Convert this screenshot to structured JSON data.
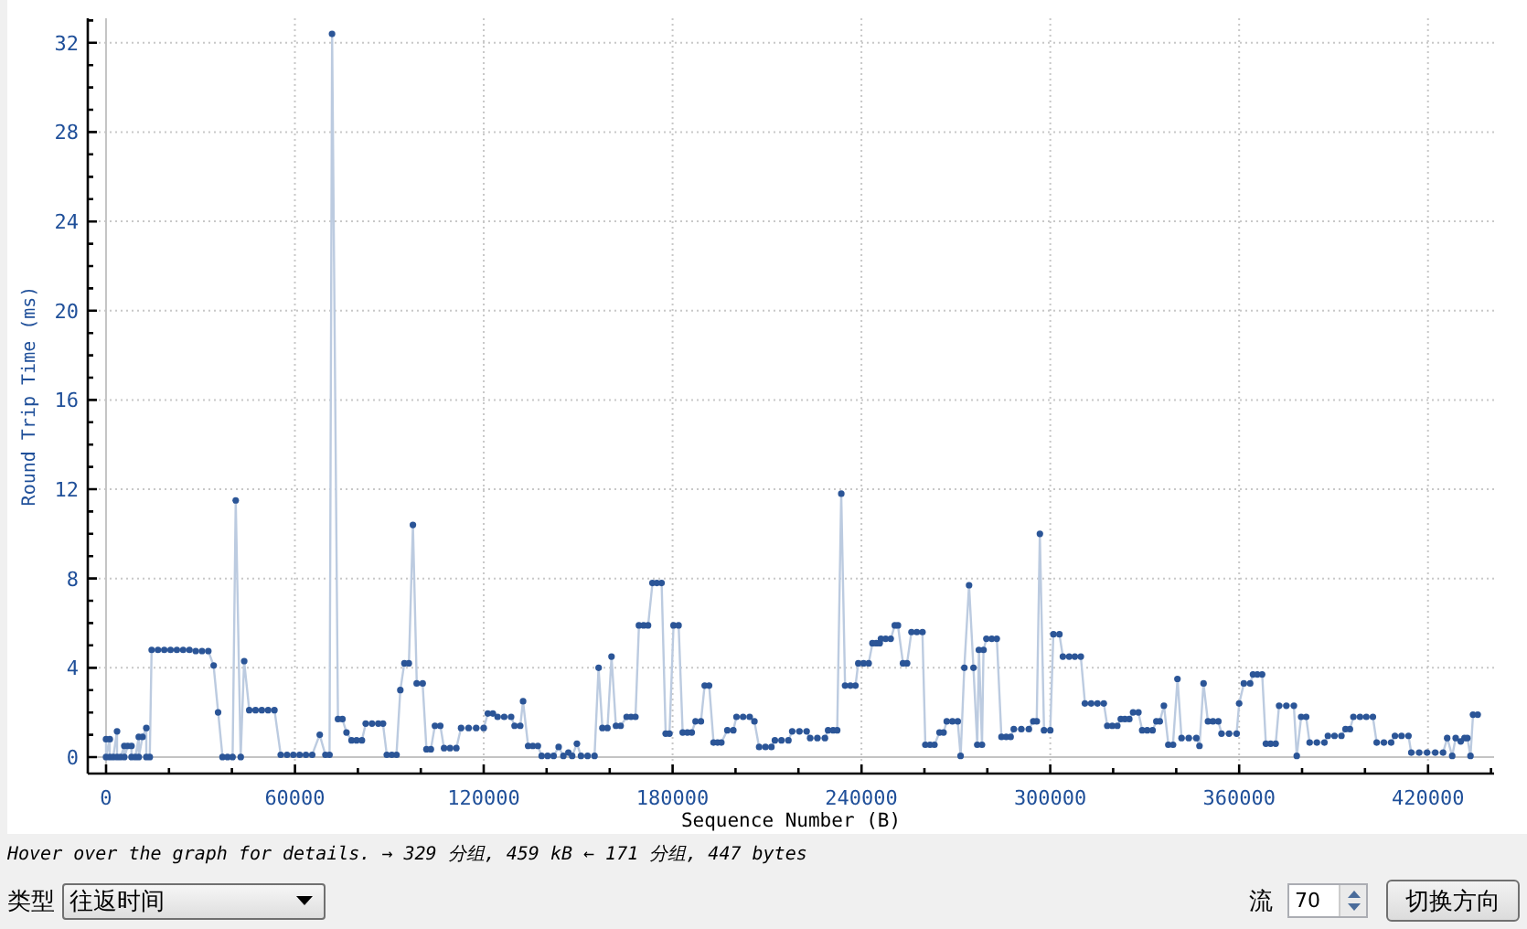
{
  "graph": {
    "chart_data": {
      "type": "line",
      "xlabel": "Sequence Number (B)",
      "ylabel": "Round Trip Time (ms)",
      "x": [
        0,
        0,
        1200,
        1200,
        2300,
        3500,
        3500,
        4600,
        5800,
        5800,
        6900,
        8100,
        8100,
        9300,
        10400,
        10400,
        11600,
        12800,
        12800,
        13900,
        14500,
        16500,
        18500,
        20500,
        22500,
        24500,
        26500,
        28500,
        30500,
        32500,
        34200,
        35600,
        37000,
        38600,
        40200,
        41200,
        42800,
        43900,
        45500,
        47500,
        49500,
        51500,
        53500,
        55500,
        57500,
        59500,
        61500,
        63500,
        65500,
        67900,
        69700,
        71000,
        71800,
        73700,
        75100,
        76400,
        78000,
        79600,
        81300,
        82500,
        84500,
        86500,
        88000,
        89200,
        90800,
        92300,
        93500,
        94800,
        96200,
        97500,
        98700,
        100600,
        101800,
        103200,
        104500,
        106200,
        107400,
        109300,
        111300,
        112800,
        115200,
        117600,
        120000,
        121300,
        122900,
        124400,
        126500,
        128700,
        129800,
        131600,
        132500,
        134100,
        135600,
        137200,
        138400,
        140300,
        142200,
        143800,
        145300,
        146900,
        148100,
        149600,
        150900,
        153000,
        155200,
        156500,
        157700,
        159300,
        160600,
        162000,
        163500,
        165400,
        166800,
        168200,
        169300,
        170800,
        172200,
        173600,
        175000,
        176500,
        177800,
        179000,
        180300,
        181900,
        183200,
        184700,
        186100,
        187300,
        189000,
        190200,
        191600,
        193000,
        194300,
        195500,
        197400,
        199300,
        200300,
        202400,
        204500,
        206000,
        207500,
        209500,
        211400,
        212500,
        214600,
        216800,
        218000,
        220300,
        222600,
        223700,
        226000,
        228400,
        229400,
        231000,
        232300,
        233600,
        234800,
        236500,
        238100,
        239000,
        240700,
        242300,
        243500,
        244700,
        245800,
        246200,
        247700,
        249300,
        250600,
        251600,
        253200,
        254500,
        255900,
        257600,
        259400,
        260300,
        261800,
        263200,
        264800,
        266100,
        267100,
        268900,
        270600,
        271500,
        272700,
        274200,
        275600,
        276800,
        277300,
        278300,
        278800,
        279700,
        281400,
        283000,
        284500,
        286000,
        287400,
        288400,
        290800,
        293200,
        294600,
        295700,
        296700,
        298000,
        300000,
        301000,
        302900,
        304000,
        306000,
        307800,
        309700,
        311000,
        313000,
        315000,
        317000,
        318100,
        319700,
        321300,
        322400,
        323700,
        325100,
        326300,
        328000,
        329200,
        330800,
        332500,
        333700,
        334800,
        336100,
        337500,
        339000,
        340400,
        341700,
        344000,
        346400,
        347400,
        348700,
        350100,
        351700,
        353400,
        354400,
        356800,
        359200,
        360000,
        361500,
        363500,
        364400,
        365800,
        367300,
        368500,
        370000,
        371600,
        372700,
        375000,
        377400,
        378300,
        379700,
        381300,
        382400,
        384700,
        387100,
        388200,
        390300,
        392500,
        393800,
        395200,
        396300,
        398400,
        400400,
        402500,
        403700,
        406000,
        408300,
        409500,
        411600,
        413800,
        414700,
        417200,
        419700,
        422300,
        424800,
        426100,
        427700,
        428800,
        430400,
        431600,
        432500,
        433500,
        434300,
        435800
      ],
      "series": [
        {
          "color": "#2b5597",
          "marker": true,
          "values": [
            0.8,
            0,
            0.8,
            0,
            0,
            1.15,
            0,
            0,
            0.5,
            0,
            0.5,
            0.5,
            0,
            0,
            0.9,
            0,
            0.9,
            1.3,
            0,
            0,
            4.8,
            4.8,
            4.8,
            4.8,
            4.8,
            4.8,
            4.8,
            4.75,
            4.75,
            4.75,
            4.1,
            2.0,
            0,
            0,
            0,
            11.5,
            0,
            4.3,
            2.1,
            2.1,
            2.1,
            2.1,
            2.1,
            0.1,
            0.1,
            0.1,
            0.1,
            0.1,
            0.1,
            1.0,
            0.1,
            0.1,
            32.4,
            1.7,
            1.7,
            1.1,
            0.75,
            0.75,
            0.75,
            1.5,
            1.5,
            1.5,
            1.5,
            0.1,
            0.1,
            0.1,
            3.0,
            4.2,
            4.2,
            10.4,
            3.3,
            3.3,
            0.35,
            0.35,
            1.4,
            1.4,
            0.4,
            0.4,
            0.4,
            1.3,
            1.3,
            1.3,
            1.3,
            1.95,
            1.95,
            1.8,
            1.8,
            1.8,
            1.4,
            1.4,
            2.5,
            0.5,
            0.5,
            0.5,
            0.05,
            0.05,
            0.05,
            0.45,
            0.05,
            0.2,
            0.05,
            0.6,
            0.05,
            0.05,
            0.05,
            4.0,
            1.3,
            1.3,
            4.5,
            1.4,
            1.4,
            1.8,
            1.8,
            1.8,
            5.9,
            5.9,
            5.9,
            7.8,
            7.8,
            7.8,
            1.05,
            1.05,
            5.9,
            5.9,
            1.1,
            1.1,
            1.1,
            1.6,
            1.6,
            3.2,
            3.2,
            0.65,
            0.65,
            0.65,
            1.2,
            1.2,
            1.8,
            1.8,
            1.8,
            1.6,
            0.45,
            0.45,
            0.45,
            0.75,
            0.75,
            0.75,
            1.15,
            1.15,
            1.15,
            0.85,
            0.85,
            0.85,
            1.2,
            1.2,
            1.2,
            11.8,
            3.2,
            3.2,
            3.2,
            4.2,
            4.2,
            4.2,
            5.1,
            5.1,
            5.1,
            5.3,
            5.3,
            5.3,
            5.9,
            5.9,
            4.2,
            4.2,
            5.6,
            5.6,
            5.6,
            0.55,
            0.55,
            0.55,
            1.1,
            1.1,
            1.6,
            1.6,
            1.6,
            0.05,
            4.0,
            7.7,
            4.0,
            0.55,
            4.8,
            0.55,
            4.8,
            5.3,
            5.3,
            5.3,
            0.9,
            0.9,
            0.9,
            1.25,
            1.25,
            1.25,
            1.6,
            1.6,
            10.0,
            1.2,
            1.2,
            5.5,
            5.5,
            4.5,
            4.5,
            4.5,
            4.5,
            2.4,
            2.4,
            2.4,
            2.4,
            1.4,
            1.4,
            1.4,
            1.7,
            1.7,
            1.7,
            2.0,
            2.0,
            1.2,
            1.2,
            1.2,
            1.6,
            1.6,
            2.3,
            0.55,
            0.55,
            3.5,
            0.85,
            0.85,
            0.85,
            0.5,
            3.3,
            1.6,
            1.6,
            1.6,
            1.05,
            1.05,
            1.05,
            2.4,
            3.3,
            3.3,
            3.7,
            3.7,
            3.7,
            0.6,
            0.6,
            0.6,
            2.3,
            2.3,
            2.3,
            0.05,
            1.8,
            1.8,
            0.65,
            0.65,
            0.65,
            0.95,
            0.95,
            0.95,
            1.25,
            1.25,
            1.8,
            1.8,
            1.8,
            1.8,
            0.65,
            0.65,
            0.65,
            0.95,
            0.95,
            0.95,
            0.2,
            0.2,
            0.2,
            0.2,
            0.2,
            0.85,
            0.05,
            0.85,
            0.7,
            0.85,
            0.85,
            0.05,
            1.9,
            1.9
          ]
        }
      ],
      "grid": true,
      "xlim": [
        -5800,
        441000
      ],
      "ylim": [
        -0.74,
        33.1
      ],
      "xticks": [
        0,
        60000,
        120000,
        180000,
        240000,
        300000,
        360000,
        420000
      ],
      "yticks": [
        0,
        4,
        8,
        12,
        16,
        20,
        24,
        28,
        32
      ]
    }
  },
  "hint": "Hover over the graph for details. → 329 分组, 459 kB ← 171 分组, 447 bytes",
  "controls": {
    "type_label": "类型",
    "type_select": {
      "value": "往返时间"
    },
    "stream_label": "流",
    "stream_spin": {
      "value": "70"
    },
    "switch_button": "切换方向"
  }
}
